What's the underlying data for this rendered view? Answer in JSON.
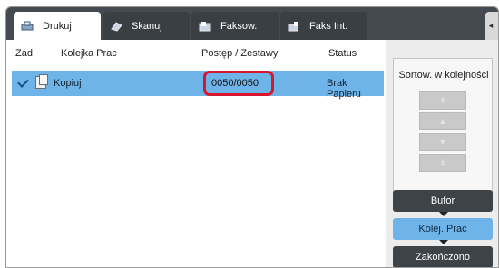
{
  "tabs": [
    {
      "label": "Drukuj",
      "icon": "printer-icon",
      "active": true
    },
    {
      "label": "Skanuj",
      "icon": "scanner-icon",
      "active": false
    },
    {
      "label": "Faksow.",
      "icon": "fax-icon",
      "active": false
    },
    {
      "label": "Faks Int.",
      "icon": "internet-fax-icon",
      "active": false
    }
  ],
  "side_toggle": "◂|",
  "table": {
    "headers": {
      "zad": "Zad.",
      "kolejka": "Kolejka Prac",
      "postep": "Postęp / Zestawy",
      "status": "Status"
    },
    "rows": [
      {
        "selected": true,
        "job": "Kopiuj",
        "progress": "0050/0050",
        "status": "Brak Papieru"
      }
    ]
  },
  "right_panel": {
    "sort_title": "Sortow. w kolejności",
    "sort_buttons": [
      "⇞",
      "▲",
      "▼",
      "⇟"
    ],
    "buttons": {
      "bufor": "Bufor",
      "kolej": "Kolej. Prac",
      "zakonczono": "Zakończono"
    }
  },
  "colors": {
    "selected_row": "#6fb4e8",
    "highlight_border": "#d8162f",
    "dark_button": "#3e4348"
  }
}
